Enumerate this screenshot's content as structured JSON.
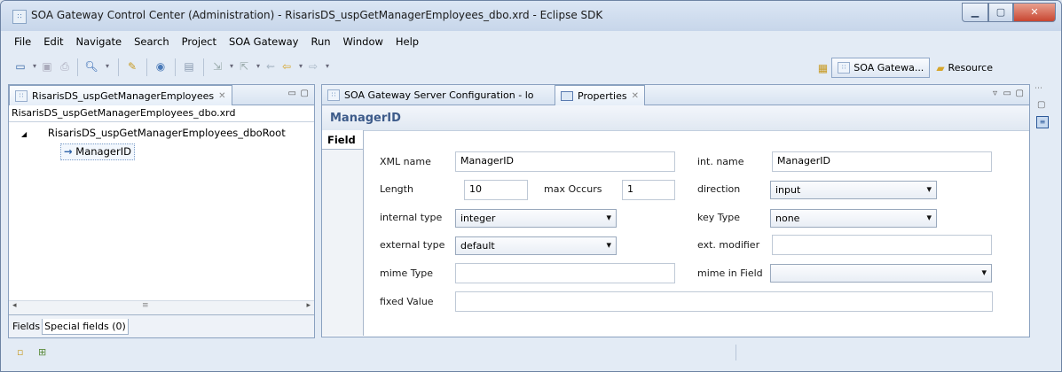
{
  "window": {
    "title": "SOA Gateway Control Center (Administration) - RisarisDS_uspGetManagerEmployees_dbo.xrd - Eclipse SDK"
  },
  "menu": [
    "File",
    "Edit",
    "Navigate",
    "Search",
    "Project",
    "SOA Gateway",
    "Run",
    "Window",
    "Help"
  ],
  "perspectives": {
    "soa": "SOA Gatewa...",
    "resource": "Resource"
  },
  "left_view": {
    "tab_label": "RisarisDS_uspGetManagerEmployees",
    "file_name": "RisarisDS_uspGetManagerEmployees_dbo.xrd",
    "tree_root": "RisarisDS_uspGetManagerEmployees_dboRoot",
    "tree_child": "ManagerID",
    "bottom_tabs": [
      "Fields",
      "Special fields (0)"
    ]
  },
  "right_view": {
    "tabs": [
      "SOA Gateway Server Configuration - lo",
      "Properties"
    ],
    "section_title": "ManagerID",
    "side_tab": "Field",
    "fields": {
      "xml_name": {
        "label": "XML name",
        "value": "ManagerID"
      },
      "int_name": {
        "label": "int. name",
        "value": "ManagerID"
      },
      "length": {
        "label": "Length",
        "value": "10"
      },
      "max_occurs": {
        "label": "max Occurs",
        "value": "1"
      },
      "direction": {
        "label": "direction",
        "value": "input"
      },
      "internal_type": {
        "label": "internal type",
        "value": "integer"
      },
      "key_type": {
        "label": "key Type",
        "value": "none"
      },
      "external_type": {
        "label": "external type",
        "value": "default"
      },
      "ext_modifier": {
        "label": "ext. modifier",
        "value": ""
      },
      "mime_type": {
        "label": "mime Type",
        "value": ""
      },
      "mime_in_field": {
        "label": "mime in Field",
        "value": ""
      },
      "fixed_value": {
        "label": "fixed Value",
        "value": ""
      }
    }
  }
}
